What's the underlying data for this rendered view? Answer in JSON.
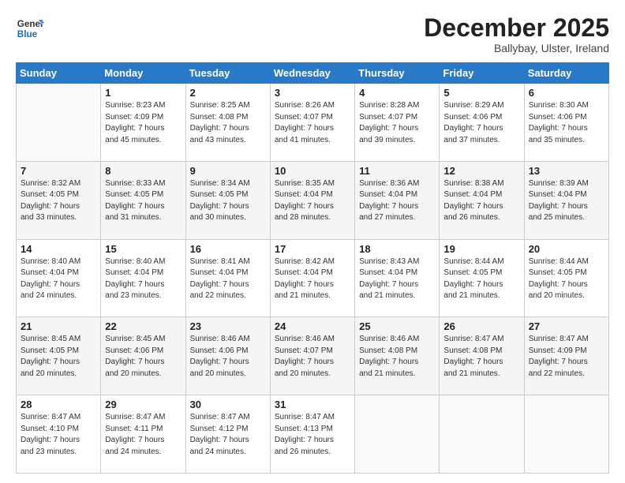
{
  "logo": {
    "line1": "General",
    "line2": "Blue"
  },
  "title": "December 2025",
  "subtitle": "Ballybay, Ulster, Ireland",
  "days_of_week": [
    "Sunday",
    "Monday",
    "Tuesday",
    "Wednesday",
    "Thursday",
    "Friday",
    "Saturday"
  ],
  "weeks": [
    [
      {
        "day": "",
        "info": ""
      },
      {
        "day": "1",
        "info": "Sunrise: 8:23 AM\nSunset: 4:09 PM\nDaylight: 7 hours\nand 45 minutes."
      },
      {
        "day": "2",
        "info": "Sunrise: 8:25 AM\nSunset: 4:08 PM\nDaylight: 7 hours\nand 43 minutes."
      },
      {
        "day": "3",
        "info": "Sunrise: 8:26 AM\nSunset: 4:07 PM\nDaylight: 7 hours\nand 41 minutes."
      },
      {
        "day": "4",
        "info": "Sunrise: 8:28 AM\nSunset: 4:07 PM\nDaylight: 7 hours\nand 39 minutes."
      },
      {
        "day": "5",
        "info": "Sunrise: 8:29 AM\nSunset: 4:06 PM\nDaylight: 7 hours\nand 37 minutes."
      },
      {
        "day": "6",
        "info": "Sunrise: 8:30 AM\nSunset: 4:06 PM\nDaylight: 7 hours\nand 35 minutes."
      }
    ],
    [
      {
        "day": "7",
        "info": "Sunrise: 8:32 AM\nSunset: 4:05 PM\nDaylight: 7 hours\nand 33 minutes."
      },
      {
        "day": "8",
        "info": "Sunrise: 8:33 AM\nSunset: 4:05 PM\nDaylight: 7 hours\nand 31 minutes."
      },
      {
        "day": "9",
        "info": "Sunrise: 8:34 AM\nSunset: 4:05 PM\nDaylight: 7 hours\nand 30 minutes."
      },
      {
        "day": "10",
        "info": "Sunrise: 8:35 AM\nSunset: 4:04 PM\nDaylight: 7 hours\nand 28 minutes."
      },
      {
        "day": "11",
        "info": "Sunrise: 8:36 AM\nSunset: 4:04 PM\nDaylight: 7 hours\nand 27 minutes."
      },
      {
        "day": "12",
        "info": "Sunrise: 8:38 AM\nSunset: 4:04 PM\nDaylight: 7 hours\nand 26 minutes."
      },
      {
        "day": "13",
        "info": "Sunrise: 8:39 AM\nSunset: 4:04 PM\nDaylight: 7 hours\nand 25 minutes."
      }
    ],
    [
      {
        "day": "14",
        "info": "Sunrise: 8:40 AM\nSunset: 4:04 PM\nDaylight: 7 hours\nand 24 minutes."
      },
      {
        "day": "15",
        "info": "Sunrise: 8:40 AM\nSunset: 4:04 PM\nDaylight: 7 hours\nand 23 minutes."
      },
      {
        "day": "16",
        "info": "Sunrise: 8:41 AM\nSunset: 4:04 PM\nDaylight: 7 hours\nand 22 minutes."
      },
      {
        "day": "17",
        "info": "Sunrise: 8:42 AM\nSunset: 4:04 PM\nDaylight: 7 hours\nand 21 minutes."
      },
      {
        "day": "18",
        "info": "Sunrise: 8:43 AM\nSunset: 4:04 PM\nDaylight: 7 hours\nand 21 minutes."
      },
      {
        "day": "19",
        "info": "Sunrise: 8:44 AM\nSunset: 4:05 PM\nDaylight: 7 hours\nand 21 minutes."
      },
      {
        "day": "20",
        "info": "Sunrise: 8:44 AM\nSunset: 4:05 PM\nDaylight: 7 hours\nand 20 minutes."
      }
    ],
    [
      {
        "day": "21",
        "info": "Sunrise: 8:45 AM\nSunset: 4:05 PM\nDaylight: 7 hours\nand 20 minutes."
      },
      {
        "day": "22",
        "info": "Sunrise: 8:45 AM\nSunset: 4:06 PM\nDaylight: 7 hours\nand 20 minutes."
      },
      {
        "day": "23",
        "info": "Sunrise: 8:46 AM\nSunset: 4:06 PM\nDaylight: 7 hours\nand 20 minutes."
      },
      {
        "day": "24",
        "info": "Sunrise: 8:46 AM\nSunset: 4:07 PM\nDaylight: 7 hours\nand 20 minutes."
      },
      {
        "day": "25",
        "info": "Sunrise: 8:46 AM\nSunset: 4:08 PM\nDaylight: 7 hours\nand 21 minutes."
      },
      {
        "day": "26",
        "info": "Sunrise: 8:47 AM\nSunset: 4:08 PM\nDaylight: 7 hours\nand 21 minutes."
      },
      {
        "day": "27",
        "info": "Sunrise: 8:47 AM\nSunset: 4:09 PM\nDaylight: 7 hours\nand 22 minutes."
      }
    ],
    [
      {
        "day": "28",
        "info": "Sunrise: 8:47 AM\nSunset: 4:10 PM\nDaylight: 7 hours\nand 23 minutes."
      },
      {
        "day": "29",
        "info": "Sunrise: 8:47 AM\nSunset: 4:11 PM\nDaylight: 7 hours\nand 24 minutes."
      },
      {
        "day": "30",
        "info": "Sunrise: 8:47 AM\nSunset: 4:12 PM\nDaylight: 7 hours\nand 24 minutes."
      },
      {
        "day": "31",
        "info": "Sunrise: 8:47 AM\nSunset: 4:13 PM\nDaylight: 7 hours\nand 26 minutes."
      },
      {
        "day": "",
        "info": ""
      },
      {
        "day": "",
        "info": ""
      },
      {
        "day": "",
        "info": ""
      }
    ]
  ]
}
